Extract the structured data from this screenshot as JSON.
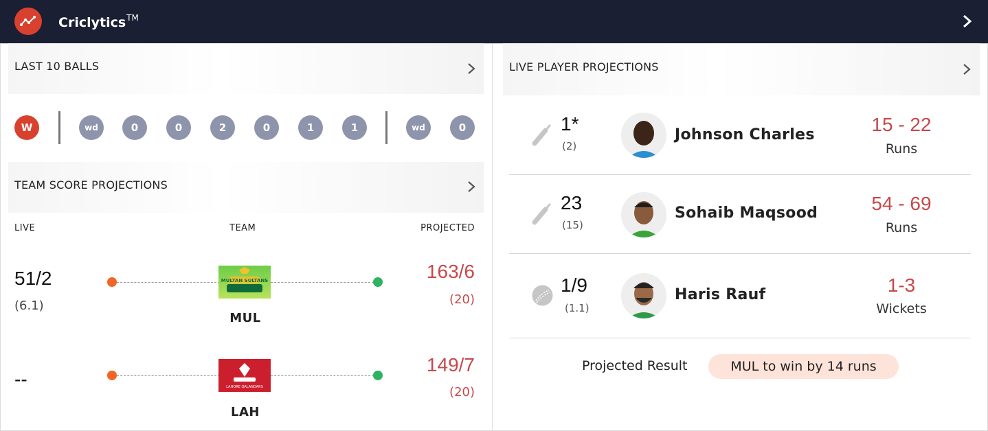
{
  "app": {
    "name": "Criclytics",
    "trademark": "TM"
  },
  "last_balls": {
    "title": "LAST 10 BALLS",
    "balls": [
      "W",
      "wd",
      "0",
      "0",
      "2",
      "0",
      "1",
      "1",
      "wd",
      "0"
    ]
  },
  "team_projections": {
    "title": "TEAM SCORE PROJECTIONS",
    "columns": {
      "live": "LIVE",
      "team": "TEAM",
      "projected": "PROJECTED"
    },
    "teams": [
      {
        "live_score": "51/2",
        "live_overs": "(6.1)",
        "code": "MUL",
        "flag_text": "MULTAN SULTANS",
        "projected_score": "163/6",
        "projected_overs": "(20)"
      },
      {
        "live_score": "--",
        "live_overs": "",
        "code": "LAH",
        "flag_text": "LAHORE QALANDARS",
        "projected_score": "149/7",
        "projected_overs": "(20)"
      }
    ]
  },
  "player_projections": {
    "title": "LIVE PLAYER PROJECTIONS",
    "players": [
      {
        "role": "bat",
        "stat": "1*",
        "sub": "(2)",
        "name": "Johnson Charles",
        "range": "15 - 22",
        "unit": "Runs"
      },
      {
        "role": "bat",
        "stat": "23",
        "sub": "(15)",
        "name": "Sohaib Maqsood",
        "range": "54 - 69",
        "unit": "Runs"
      },
      {
        "role": "ball",
        "stat": "1/9",
        "sub": "(1.1)",
        "name": "Haris Rauf",
        "range": "1-3",
        "unit": "Wickets"
      }
    ]
  },
  "result": {
    "label": "Projected Result",
    "value": "MUL to win by 14 runs"
  },
  "colors": {
    "header_bg": "#1a1f33",
    "accent_red": "#d9412f",
    "projection_red": "#c8484a",
    "ball_grey": "#8e94ab",
    "dot_orange": "#f26522",
    "dot_green": "#2eb360",
    "pill_bg": "#fde3d9"
  }
}
